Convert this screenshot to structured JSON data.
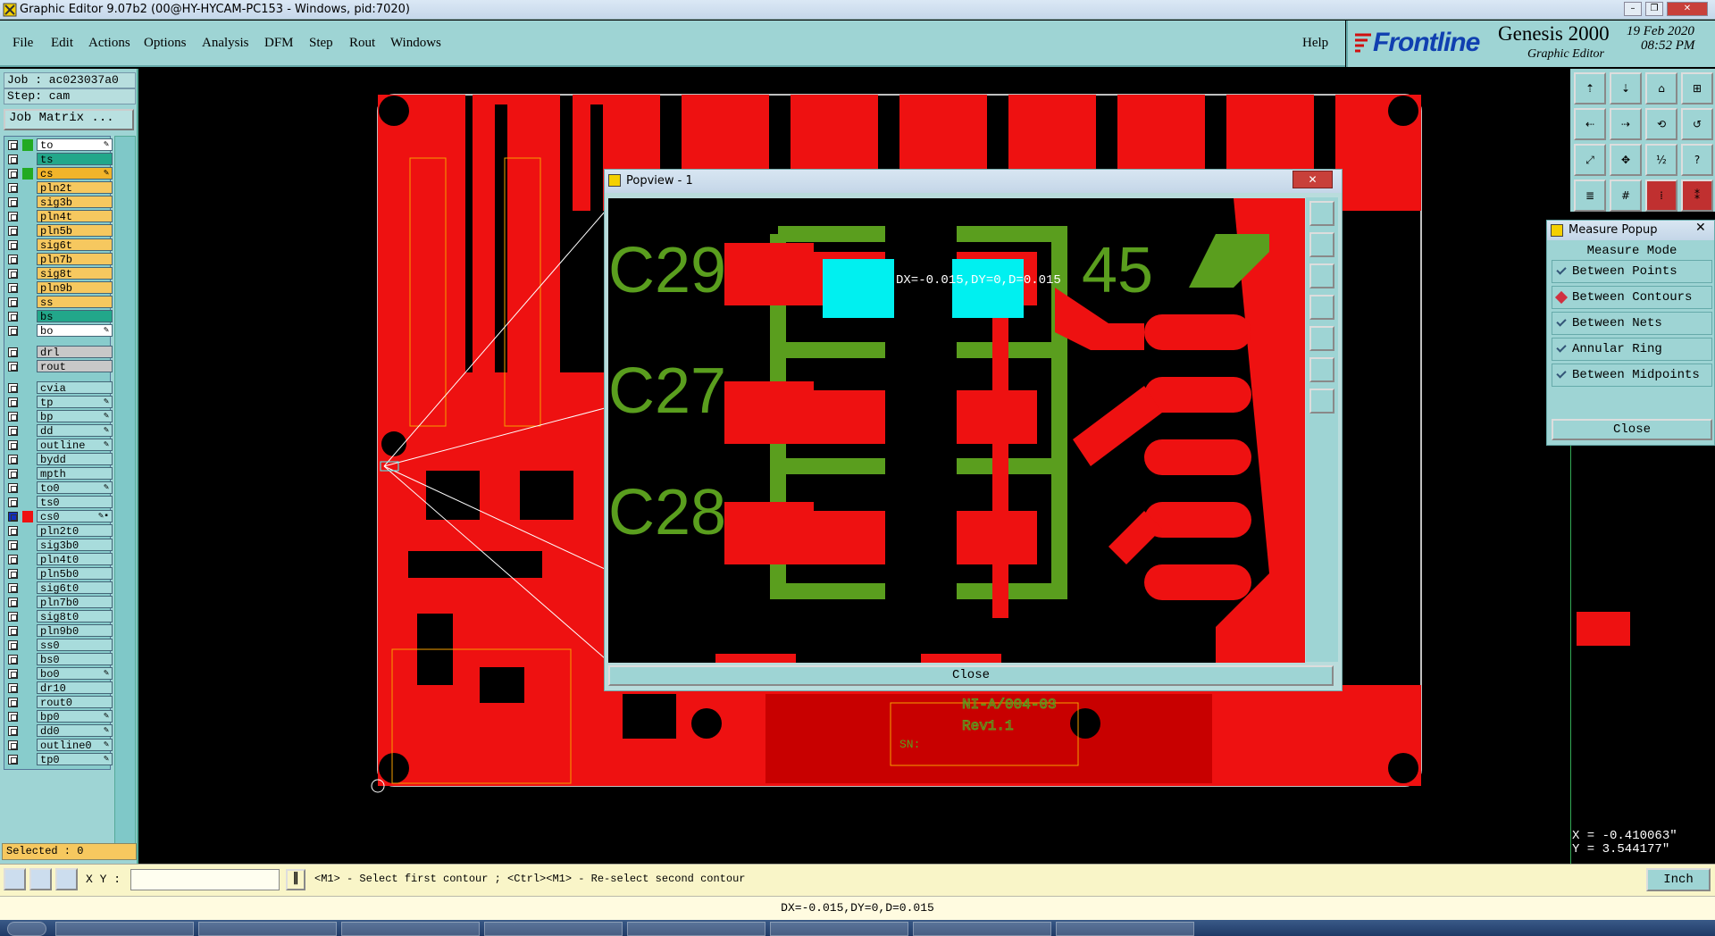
{
  "window": {
    "title": "Graphic Editor 9.07b2 (00@HY-HYCAM-PC153 - Windows, pid:7020)"
  },
  "menu": {
    "items": [
      "File",
      "Edit",
      "Actions",
      "Options",
      "Analysis",
      "DFM",
      "Step",
      "Rout",
      "Windows"
    ],
    "help": "Help"
  },
  "brand": {
    "logo": "Frontline",
    "product": "Genesis 2000",
    "subtitle": "Graphic Editor",
    "date": "19 Feb 2020",
    "time": "08:52 PM"
  },
  "job": {
    "job_label": "Job : ac023037a0",
    "step_label": "Step: cam",
    "job_matrix_button": "Job Matrix ..."
  },
  "layers": [
    {
      "name": "to",
      "color": "#ffffff",
      "swatch": "#22aa22",
      "mark": "✎"
    },
    {
      "name": "ts",
      "color": "#22a78a",
      "swatch": "",
      "mark": ""
    },
    {
      "name": "cs",
      "color": "#f2b42a",
      "swatch": "#22aa22",
      "mark": "✎"
    },
    {
      "name": "pln2t",
      "color": "#f6c85f",
      "swatch": "",
      "mark": ""
    },
    {
      "name": "sig3b",
      "color": "#f6c85f",
      "swatch": "",
      "mark": ""
    },
    {
      "name": "pln4t",
      "color": "#f6c85f",
      "swatch": "",
      "mark": ""
    },
    {
      "name": "pln5b",
      "color": "#f6c85f",
      "swatch": "",
      "mark": ""
    },
    {
      "name": "sig6t",
      "color": "#f6c85f",
      "swatch": "",
      "mark": ""
    },
    {
      "name": "pln7b",
      "color": "#f6c85f",
      "swatch": "",
      "mark": ""
    },
    {
      "name": "sig8t",
      "color": "#f6c85f",
      "swatch": "",
      "mark": ""
    },
    {
      "name": "pln9b",
      "color": "#f6c85f",
      "swatch": "",
      "mark": ""
    },
    {
      "name": "ss",
      "color": "#f6c85f",
      "swatch": "",
      "mark": ""
    },
    {
      "name": "bs",
      "color": "#22a78a",
      "swatch": "",
      "mark": ""
    },
    {
      "name": "bo",
      "color": "#ffffff",
      "swatch": "",
      "mark": "✎"
    },
    {
      "name": "drl",
      "color": "#c8c8c8",
      "swatch": "",
      "mark": ""
    },
    {
      "name": "rout",
      "color": "#c8c8c8",
      "swatch": "",
      "mark": ""
    },
    {
      "name": "cvia",
      "color": "#a8dcdc",
      "swatch": "",
      "mark": ""
    },
    {
      "name": "tp",
      "color": "#a8dcdc",
      "swatch": "",
      "mark": "✎"
    },
    {
      "name": "bp",
      "color": "#a8dcdc",
      "swatch": "",
      "mark": "✎"
    },
    {
      "name": "dd",
      "color": "#a8dcdc",
      "swatch": "",
      "mark": "✎"
    },
    {
      "name": "outline",
      "color": "#a8dcdc",
      "swatch": "",
      "mark": "✎"
    },
    {
      "name": "bydd",
      "color": "#a8dcdc",
      "swatch": "",
      "mark": ""
    },
    {
      "name": "mpth",
      "color": "#a8dcdc",
      "swatch": "",
      "mark": ""
    },
    {
      "name": "to0",
      "color": "#a8dcdc",
      "swatch": "",
      "mark": "✎"
    },
    {
      "name": "ts0",
      "color": "#a8dcdc",
      "swatch": "",
      "mark": ""
    },
    {
      "name": "cs0",
      "color": "#a8dcdc",
      "swatch": "#ee1111",
      "mark": "✎▪"
    },
    {
      "name": "pln2t0",
      "color": "#a8dcdc",
      "swatch": "",
      "mark": ""
    },
    {
      "name": "sig3b0",
      "color": "#a8dcdc",
      "swatch": "",
      "mark": ""
    },
    {
      "name": "pln4t0",
      "color": "#a8dcdc",
      "swatch": "",
      "mark": ""
    },
    {
      "name": "pln5b0",
      "color": "#a8dcdc",
      "swatch": "",
      "mark": ""
    },
    {
      "name": "sig6t0",
      "color": "#a8dcdc",
      "swatch": "",
      "mark": ""
    },
    {
      "name": "pln7b0",
      "color": "#a8dcdc",
      "swatch": "",
      "mark": ""
    },
    {
      "name": "sig8t0",
      "color": "#a8dcdc",
      "swatch": "",
      "mark": ""
    },
    {
      "name": "pln9b0",
      "color": "#a8dcdc",
      "swatch": "",
      "mark": ""
    },
    {
      "name": "ss0",
      "color": "#a8dcdc",
      "swatch": "",
      "mark": ""
    },
    {
      "name": "bs0",
      "color": "#a8dcdc",
      "swatch": "",
      "mark": ""
    },
    {
      "name": "bo0",
      "color": "#a8dcdc",
      "swatch": "",
      "mark": "✎"
    },
    {
      "name": "dr10",
      "color": "#a8dcdc",
      "swatch": "",
      "mark": ""
    },
    {
      "name": "rout0",
      "color": "#a8dcdc",
      "swatch": "",
      "mark": ""
    },
    {
      "name": "bp0",
      "color": "#a8dcdc",
      "swatch": "",
      "mark": "✎"
    },
    {
      "name": "dd0",
      "color": "#a8dcdc",
      "swatch": "",
      "mark": "✎"
    },
    {
      "name": "outline0",
      "color": "#a8dcdc",
      "swatch": "",
      "mark": "✎"
    },
    {
      "name": "tp0",
      "color": "#a8dcdc",
      "swatch": "",
      "mark": "✎"
    }
  ],
  "selected": "Selected : 0",
  "popview": {
    "title": "Popview - 1",
    "close_button": "Close",
    "labels": [
      "C29",
      "C27",
      "C28",
      "45"
    ],
    "measure_readout": "DX=-0.015,DY=0,D=0.015"
  },
  "board": {
    "silk_text": [
      "NI-A/004-03",
      "Rev1.1",
      "SN:"
    ]
  },
  "measure_popup": {
    "title": "Measure Popup",
    "mode_header": "Measure Mode",
    "options": [
      {
        "label": "Between Points",
        "selected": false
      },
      {
        "label": "Between Contours",
        "selected": true
      },
      {
        "label": "Between Nets",
        "selected": false
      },
      {
        "label": "Annular Ring",
        "selected": false
      },
      {
        "label": "Between Midpoints",
        "selected": false
      }
    ],
    "close_button": "Close"
  },
  "coords": {
    "x": "X = -0.410063\"",
    "y": "Y = 3.544177\""
  },
  "bottom": {
    "xy_label": "X Y :",
    "xy_value": "",
    "prompt": "<M1> - Select first contour ; <Ctrl><M1> - Re-select second contour",
    "units": "Inch"
  },
  "status": "DX=-0.015,DY=0,D=0.015",
  "colors": {
    "panel": "#9ed4d4",
    "copper": "#ee1111",
    "silk": "#5a9e1e",
    "highlight": "#00f0f0"
  }
}
